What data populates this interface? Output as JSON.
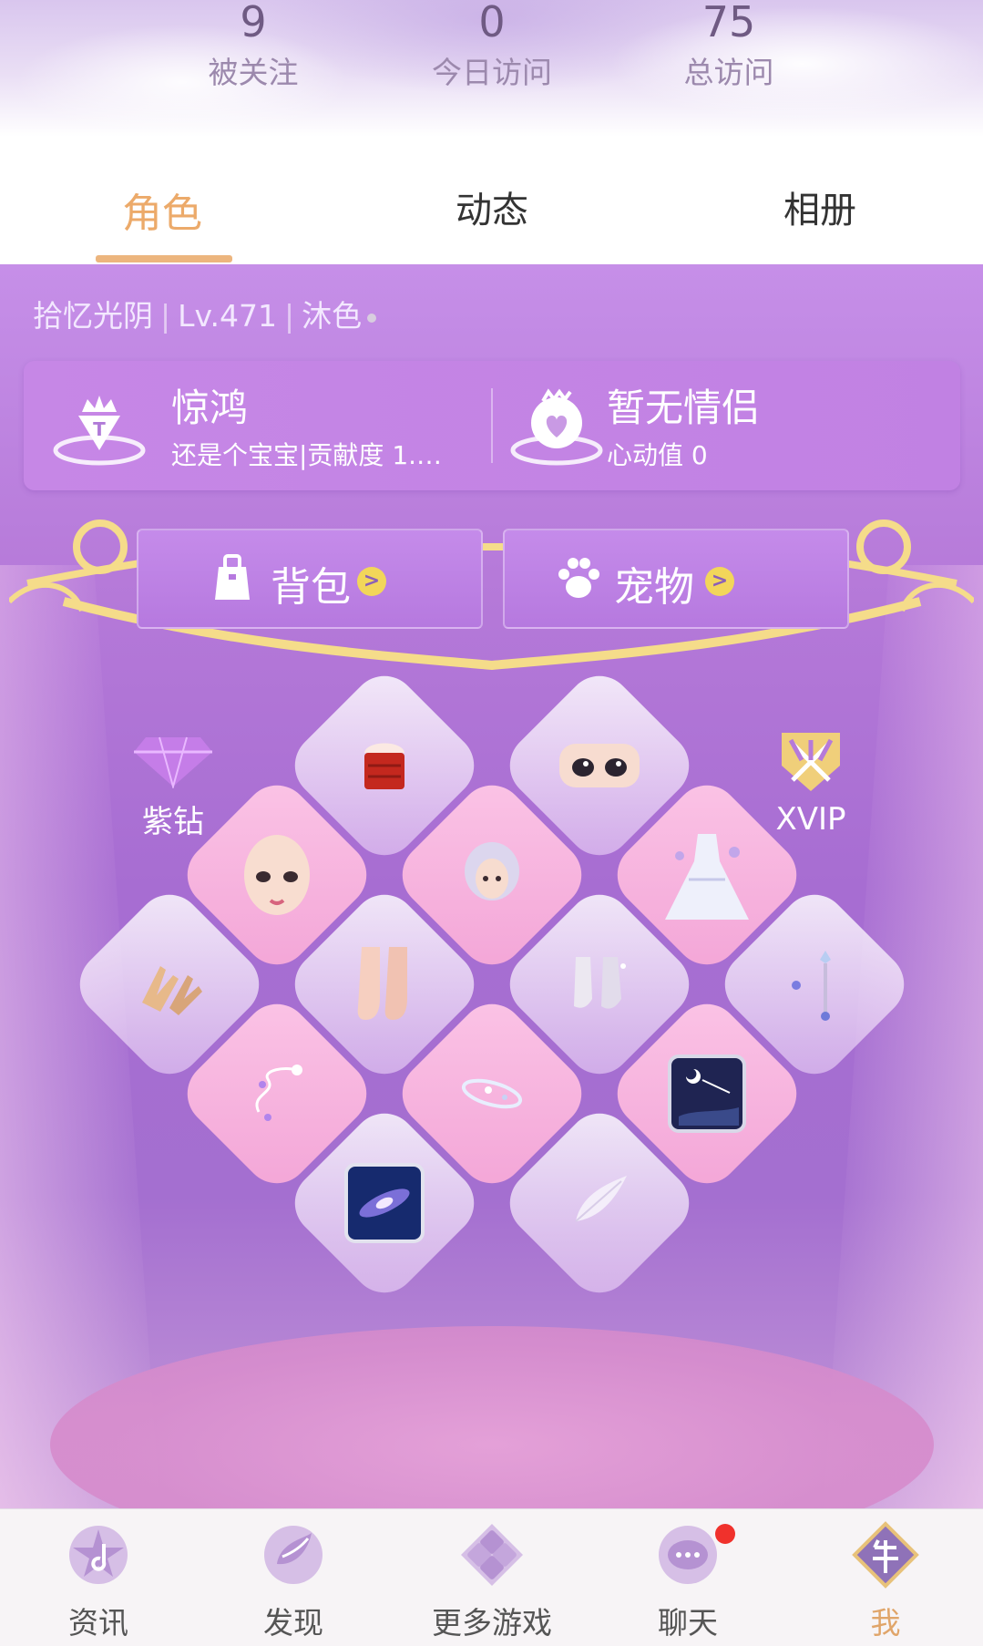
{
  "stats": [
    {
      "value": "9",
      "label": "被关注"
    },
    {
      "value": "0",
      "label": "今日访问"
    },
    {
      "value": "75",
      "label": "总访问"
    }
  ],
  "tabs": [
    {
      "label": "角色",
      "active": true
    },
    {
      "label": "动态",
      "active": false
    },
    {
      "label": "相册",
      "active": false
    }
  ],
  "role": {
    "name": "拾忆光阴",
    "level": "Lv.471",
    "server": "沐色"
  },
  "guild": {
    "title": "惊鸿",
    "sub": "还是个宝宝|贡献度 1.…"
  },
  "couple": {
    "title": "暂无情侣",
    "sub": "心动值 0"
  },
  "buttons": {
    "bag": "背包",
    "pet": "宠物",
    "arrow": ">"
  },
  "badges": {
    "diamond": "紫钻",
    "vip": "XVIP"
  },
  "items": [
    {
      "name": "tube-top-item-icon"
    },
    {
      "name": "eyes-item-icon"
    },
    {
      "name": "face-item-icon"
    },
    {
      "name": "hairstyle-item-icon"
    },
    {
      "name": "wedding-dress-item-icon"
    },
    {
      "name": "hands-item-icon"
    },
    {
      "name": "feet-item-icon"
    },
    {
      "name": "shoes-item-icon"
    },
    {
      "name": "wand-item-icon"
    },
    {
      "name": "sparkle-trail-item-icon"
    },
    {
      "name": "halo-item-icon"
    },
    {
      "name": "night-sky-background-icon"
    },
    {
      "name": "galaxy-background-icon"
    },
    {
      "name": "feather-item-icon"
    }
  ],
  "nav": [
    {
      "label": "资讯",
      "icon": "news-icon",
      "active": false
    },
    {
      "label": "发现",
      "icon": "discover-icon",
      "active": false
    },
    {
      "label": "更多游戏",
      "icon": "more-games-icon",
      "active": false
    },
    {
      "label": "聊天",
      "icon": "chat-icon",
      "active": false,
      "badge": true
    },
    {
      "label": "我",
      "icon": "me-icon",
      "active": true
    }
  ],
  "colors": {
    "accent": "#ecaa6a",
    "stage": "#b67ad9",
    "badge": "#f0312c"
  }
}
